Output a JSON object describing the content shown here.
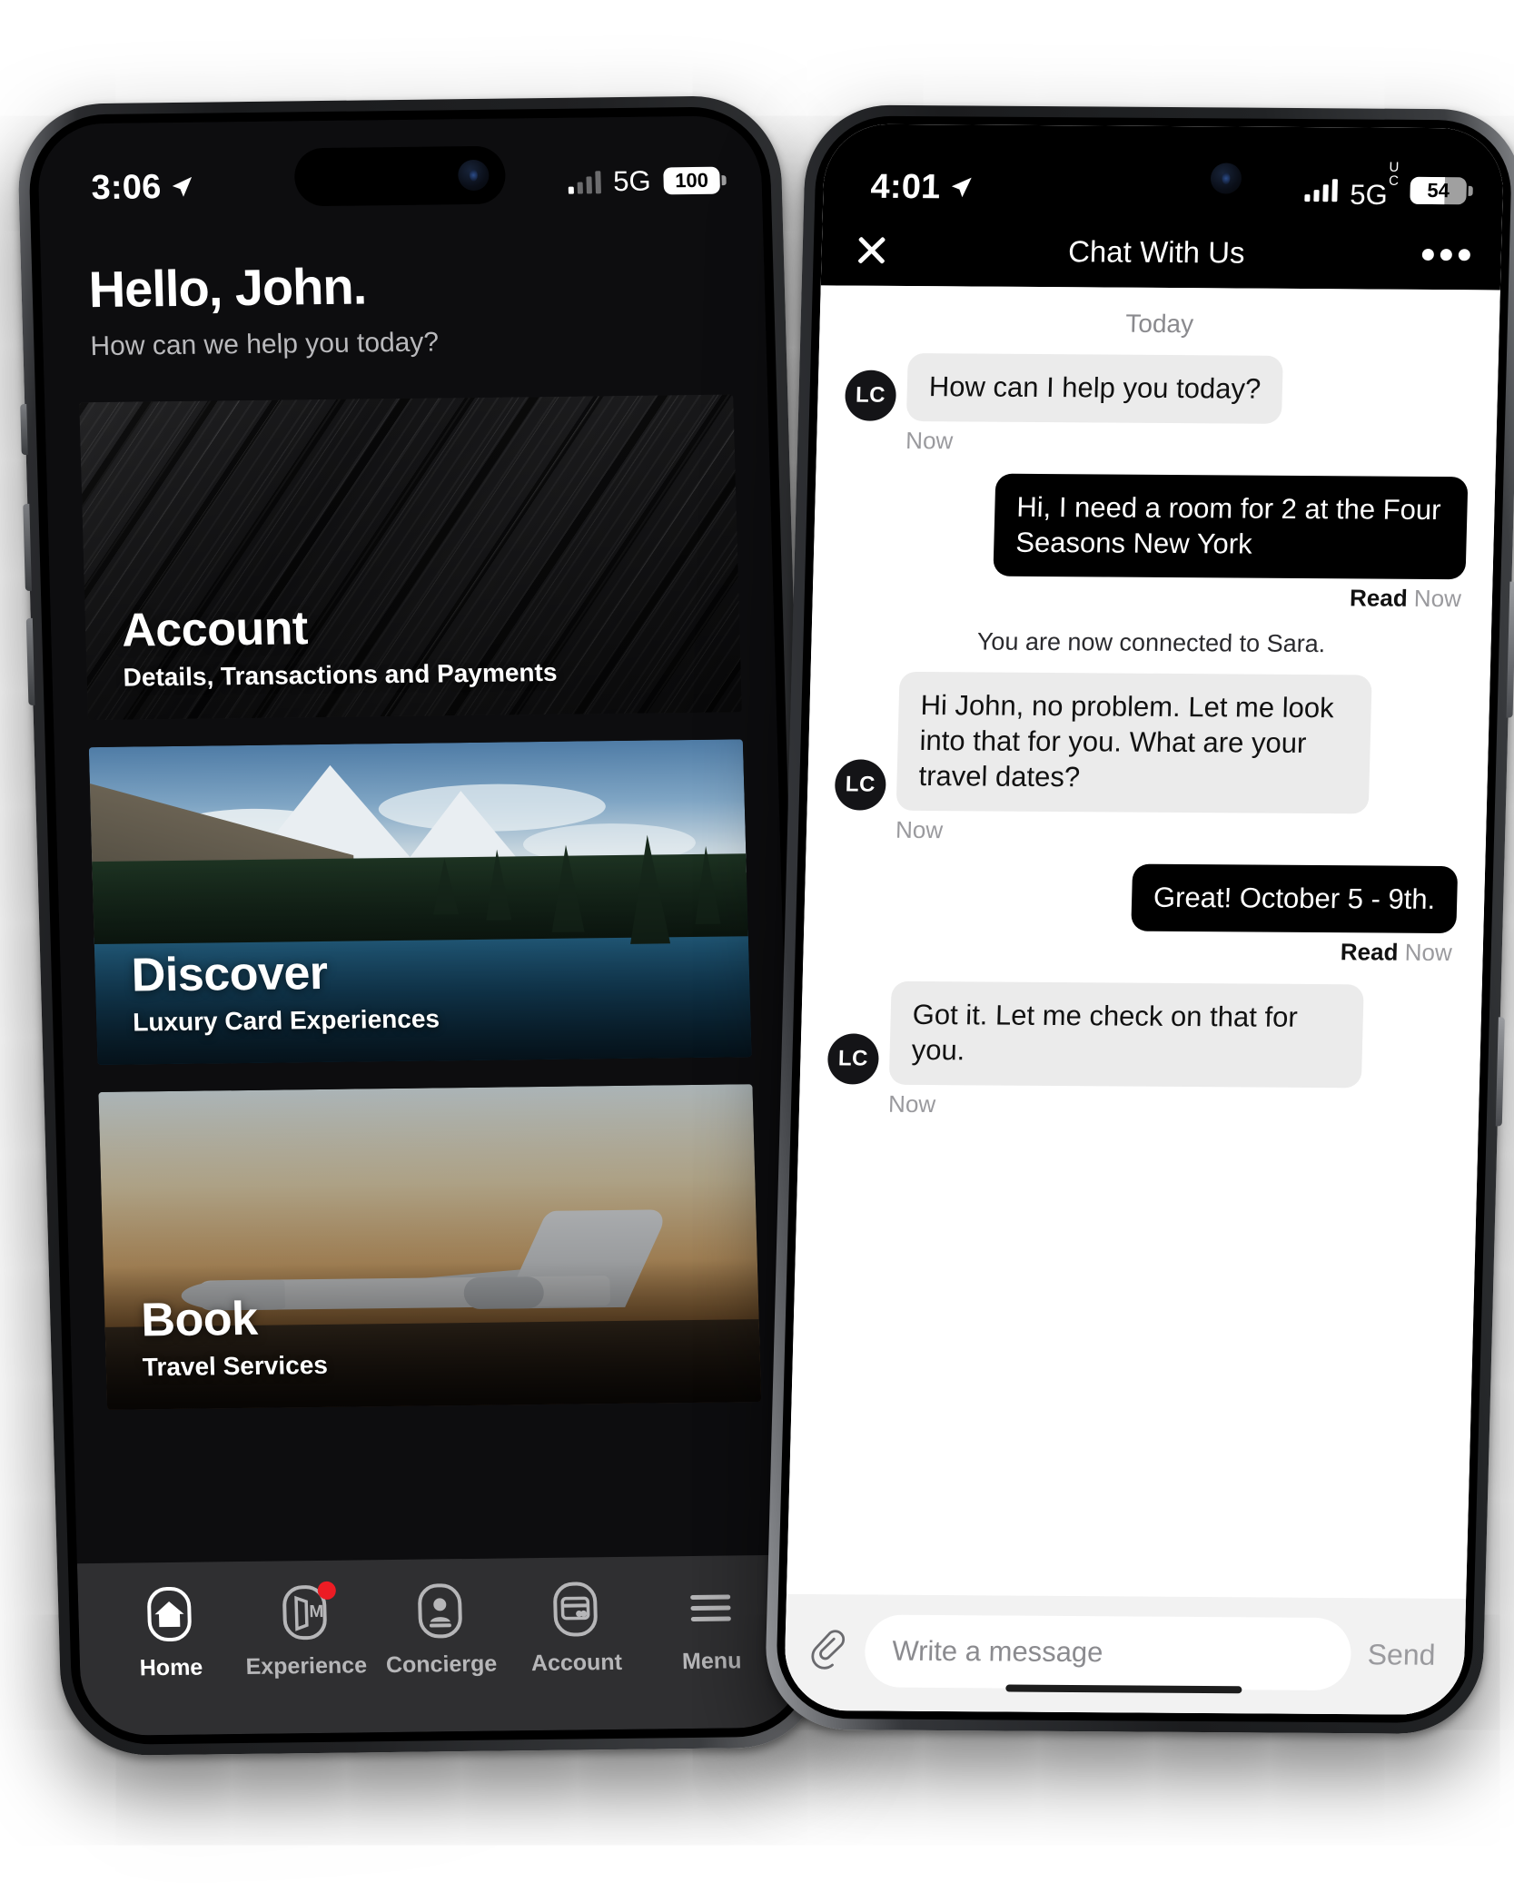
{
  "phone_left": {
    "status_bar": {
      "time": "3:06",
      "location_icon": "location-arrow-icon",
      "network": "5G",
      "battery_percent": "100",
      "signal_icon": "cellular-signal-icon"
    },
    "greeting": {
      "title": "Hello, John.",
      "subtitle": "How can we help you today?"
    },
    "cards": [
      {
        "title": "Account",
        "subtitle": "Details, Transactions and Payments",
        "art": "dark-brushed-metal"
      },
      {
        "title": "Discover",
        "subtitle": "Luxury Card Experiences",
        "art": "mountain-lake"
      },
      {
        "title": "Book",
        "subtitle": "Travel Services",
        "art": "private-jet-dusk"
      }
    ],
    "tabbar": [
      {
        "label": "Home",
        "icon": "home-icon",
        "active": true,
        "badge": false
      },
      {
        "label": "Experience",
        "icon": "experience-icon",
        "active": false,
        "badge": true
      },
      {
        "label": "Concierge",
        "icon": "concierge-icon",
        "active": false,
        "badge": false
      },
      {
        "label": "Account",
        "icon": "card-icon",
        "active": false,
        "badge": false
      },
      {
        "label": "Menu",
        "icon": "hamburger-icon",
        "active": false,
        "badge": false
      }
    ]
  },
  "phone_right": {
    "status_bar": {
      "time": "4:01",
      "location_icon": "location-arrow-icon",
      "network": "5G",
      "network_sup_top": "U",
      "network_sup_bottom": "C",
      "battery_percent": "54",
      "signal_icon": "cellular-signal-icon"
    },
    "header": {
      "close_icon": "close-icon",
      "title": "Chat With Us",
      "more_icon": "more-options-icon"
    },
    "day_separator": "Today",
    "messages": [
      {
        "side": "them",
        "avatar": "LC",
        "text": "How can I help you today?",
        "meta": "Now",
        "read": ""
      },
      {
        "side": "me",
        "avatar": "",
        "text": "Hi, I need a room for 2 at the Four Seasons New York",
        "meta": "Now",
        "read": "Read"
      },
      {
        "side": "system",
        "text": "You are now connected to Sara."
      },
      {
        "side": "them",
        "avatar": "LC",
        "text": "Hi John, no problem. Let me look into that for you. What are your travel dates?",
        "meta": "Now",
        "read": ""
      },
      {
        "side": "me",
        "avatar": "",
        "text": "Great! October 5 - 9th.",
        "meta": "Now",
        "read": "Read"
      },
      {
        "side": "them",
        "avatar": "LC",
        "text": "Got it.  Let me check on that for you.",
        "meta": "Now",
        "read": ""
      }
    ],
    "composer": {
      "attach_icon": "paperclip-icon",
      "input_value": "",
      "input_placeholder": "Write a message",
      "send_label": "Send"
    }
  },
  "colors": {
    "accent_badge": "#ec1c24",
    "app_bg_dark": "#0d0d0f",
    "tabbar_bg": "#2f2f31",
    "bubble_them": "#ebebeb",
    "bubble_me": "#000000",
    "composer_bg": "#f2f2f2"
  }
}
